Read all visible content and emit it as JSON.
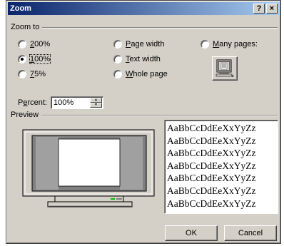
{
  "window": {
    "title": "Zoom",
    "help_label": "?",
    "close_label": "×"
  },
  "zoom_to": {
    "label": "Zoom to",
    "options": {
      "z200": "200%",
      "z100": "100%",
      "z75": "75%",
      "page_width": "Page width",
      "text_width": "Text width",
      "whole_page": "Whole page",
      "many_pages": "Many pages:"
    },
    "selected": "100%"
  },
  "percent": {
    "label": "Percent:",
    "value": "100%"
  },
  "preview": {
    "label": "Preview",
    "sample_lines": [
      "AaBbCcDdEeXxYyZz",
      "AaBbCcDdEeXxYyZz",
      "AaBbCcDdEeXxYyZz",
      "AaBbCcDdEeXxYyZz",
      "AaBbCcDdEeXxYyZz",
      "AaBbCcDdEeXxYyZz",
      "AaBbCcDdEeXxYyZz"
    ]
  },
  "buttons": {
    "ok": "OK",
    "cancel": "Cancel"
  },
  "colors": {
    "titlebar_start": "#0a246a",
    "titlebar_end": "#a6caf0",
    "face": "#d4d0c8"
  }
}
